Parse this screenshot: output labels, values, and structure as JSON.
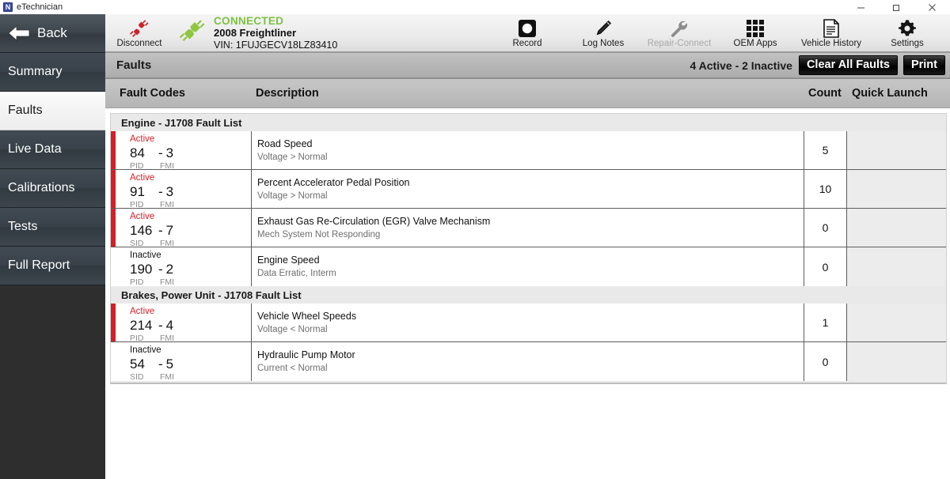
{
  "window": {
    "app_icon": "app-logo-icon",
    "title": "eTechnician",
    "controls": {
      "minimize": "minimize-icon",
      "maximize": "maximize-icon",
      "close": "close-icon"
    }
  },
  "sidebar": {
    "back_label": "Back",
    "items": [
      {
        "label": "Summary",
        "active": false
      },
      {
        "label": "Faults",
        "active": true
      },
      {
        "label": "Live Data",
        "active": false
      },
      {
        "label": "Calibrations",
        "active": false
      },
      {
        "label": "Tests",
        "active": false
      },
      {
        "label": "Full Report",
        "active": false
      }
    ]
  },
  "toolbar": {
    "disconnect": {
      "label": "Disconnect",
      "icon": "broken-plug-icon"
    },
    "connection": {
      "icon": "connected-plug-icon",
      "status": "CONNECTED",
      "status_color": "#7cc241",
      "vehicle": "2008 Freightliner",
      "vin": "VIN: 1FUJGECV18LZ83410"
    },
    "actions": [
      {
        "label": "Record",
        "icon": "record-icon",
        "disabled": false
      },
      {
        "label": "Log Notes",
        "icon": "pencil-icon",
        "disabled": false
      },
      {
        "label": "Repair-Connect",
        "icon": "wrench-icon",
        "disabled": true
      },
      {
        "label": "OEM Apps",
        "icon": "grid-apps-icon",
        "disabled": false
      },
      {
        "label": "Vehicle History",
        "icon": "document-icon",
        "disabled": false
      },
      {
        "label": "Settings",
        "icon": "gear-icon",
        "disabled": false
      }
    ]
  },
  "faults_bar": {
    "title": "Faults",
    "counts": "4 Active - 2 Inactive",
    "clear_all_label": "Clear All Faults",
    "print_label": "Print"
  },
  "columns": {
    "fault_codes": "Fault Codes",
    "description": "Description",
    "count": "Count",
    "quick_launch": "Quick Launch"
  },
  "groups": [
    {
      "header": "Engine - J1708 Fault List",
      "rows": [
        {
          "state": "Active",
          "active": true,
          "code": "84",
          "fmi": "3",
          "code_label": "PID",
          "fmi_label": "FMI",
          "description": "Road Speed",
          "sub": "Voltage > Normal",
          "count": "5"
        },
        {
          "state": "Active",
          "active": true,
          "code": "91",
          "fmi": "3",
          "code_label": "PID",
          "fmi_label": "FMI",
          "description": "Percent Accelerator Pedal Position",
          "sub": "Voltage > Normal",
          "count": "10"
        },
        {
          "state": "Active",
          "active": true,
          "code": "146",
          "fmi": "7",
          "code_label": "SID",
          "fmi_label": "FMI",
          "description": "Exhaust Gas Re-Circulation (EGR) Valve Mechanism",
          "sub": "Mech System Not Responding",
          "count": "0"
        },
        {
          "state": "Inactive",
          "active": false,
          "code": "190",
          "fmi": "2",
          "code_label": "PID",
          "fmi_label": "FMI",
          "description": "Engine Speed",
          "sub": "Data Erratic, Interm",
          "count": "0"
        }
      ]
    },
    {
      "header": "Brakes, Power Unit - J1708 Fault List",
      "rows": [
        {
          "state": "Active",
          "active": true,
          "code": "214",
          "fmi": "4",
          "code_label": "PID",
          "fmi_label": "FMI",
          "description": "Vehicle Wheel Speeds",
          "sub": "Voltage < Normal",
          "count": "1"
        },
        {
          "state": "Inactive",
          "active": false,
          "code": "54",
          "fmi": "5",
          "code_label": "SID",
          "fmi_label": "FMI",
          "description": "Hydraulic Pump Motor",
          "sub": "Current < Normal",
          "count": "0"
        }
      ]
    }
  ],
  "colors": {
    "active_red": "#d81f26",
    "connected_green": "#7cc241",
    "sidebar_dark": "#2e2e2e"
  }
}
